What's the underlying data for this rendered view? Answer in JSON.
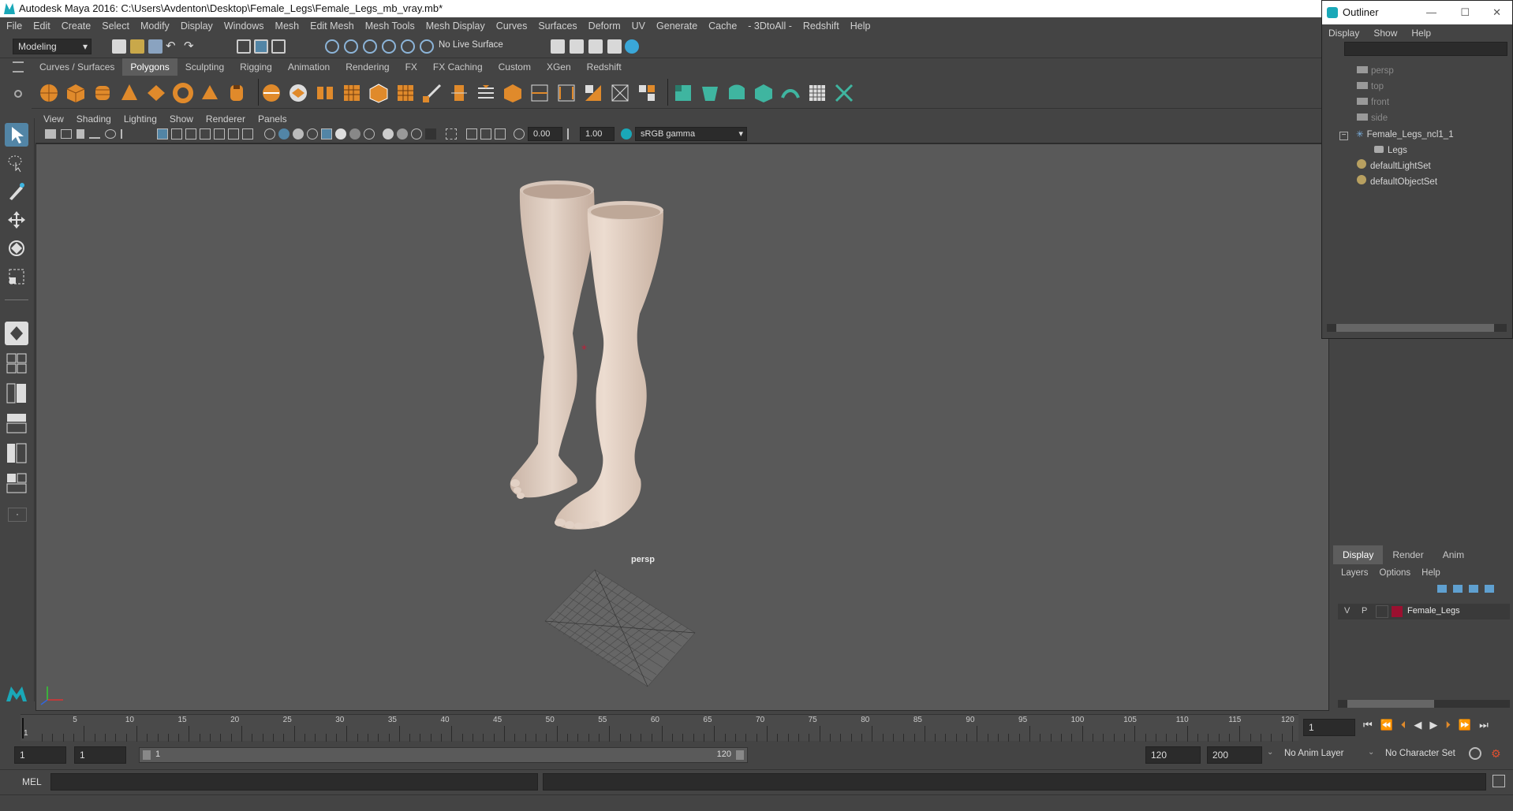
{
  "window": {
    "title": "Autodesk Maya 2016: C:\\Users\\Avdenton\\Desktop\\Female_Legs\\Female_Legs_mb_vray.mb*"
  },
  "menubar": {
    "items": [
      "File",
      "Edit",
      "Create",
      "Select",
      "Modify",
      "Display",
      "Windows",
      "Mesh",
      "Edit Mesh",
      "Mesh Tools",
      "Mesh Display",
      "Curves",
      "Surfaces",
      "Deform",
      "UV",
      "Generate",
      "Cache",
      "- 3DtoAll -",
      "Redshift",
      "Help"
    ]
  },
  "statusline": {
    "mode": "Modeling",
    "live_surface": "No Live Surface"
  },
  "shelf": {
    "tabs": [
      "Curves / Surfaces",
      "Polygons",
      "Sculpting",
      "Rigging",
      "Animation",
      "Rendering",
      "FX",
      "FX Caching",
      "Custom",
      "XGen",
      "Redshift"
    ],
    "active_tab": "Polygons"
  },
  "viewport": {
    "menu": [
      "View",
      "Shading",
      "Lighting",
      "Show",
      "Renderer",
      "Panels"
    ],
    "exposure": "0.00",
    "gamma": "1.00",
    "color_space": "sRGB gamma",
    "camera_label": "persp"
  },
  "outliner": {
    "title": "Outliner",
    "menu": [
      "Display",
      "Show",
      "Help"
    ],
    "items": [
      {
        "label": "persp",
        "dim": true
      },
      {
        "label": "top",
        "dim": true
      },
      {
        "label": "front",
        "dim": true
      },
      {
        "label": "side",
        "dim": true
      },
      {
        "label": "Female_Legs_ncl1_1",
        "dim": false
      },
      {
        "label": "Legs",
        "dim": false
      },
      {
        "label": "defaultLightSet",
        "dim": false
      },
      {
        "label": "defaultObjectSet",
        "dim": false
      }
    ]
  },
  "layer_editor": {
    "tabs": [
      "Display",
      "Render",
      "Anim"
    ],
    "active_tab": "Display",
    "menu": [
      "Layers",
      "Options",
      "Help"
    ],
    "layer": {
      "v": "V",
      "p": "P",
      "name": "Female_Legs",
      "color": "#9b1030"
    }
  },
  "timeline": {
    "ticks": [
      "5",
      "10",
      "15",
      "20",
      "25",
      "30",
      "35",
      "40",
      "45",
      "50",
      "55",
      "60",
      "65",
      "70",
      "75",
      "80",
      "85",
      "90",
      "95",
      "100",
      "105",
      "110",
      "115",
      "120"
    ],
    "first_marker": "1",
    "current_frame": "1"
  },
  "range": {
    "start": "1",
    "playback_start": "1",
    "slider_start": "1",
    "slider_end": "120",
    "playback_end": "120",
    "end": "200",
    "anim_layer": "No Anim Layer",
    "character_set": "No Character Set"
  },
  "command_line": {
    "label": "MEL"
  },
  "colors": {
    "accent": "#5285a6",
    "shelf_orange": "#e08a2b",
    "shelf_green": "#3fb5a0"
  }
}
